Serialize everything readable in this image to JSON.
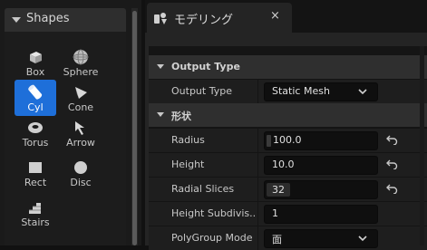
{
  "shapes_panel": {
    "title": "Shapes",
    "tools": [
      {
        "label": "Box",
        "icon": "box-icon"
      },
      {
        "label": "Sphere",
        "icon": "sphere-icon"
      },
      {
        "label": "Cyl",
        "icon": "cylinder-icon",
        "active": true
      },
      {
        "label": "Cone",
        "icon": "cone-icon"
      },
      {
        "label": "Torus",
        "icon": "torus-icon"
      },
      {
        "label": "Arrow",
        "icon": "arrow-icon"
      },
      {
        "label": "Rect",
        "icon": "rect-icon"
      },
      {
        "label": "Disc",
        "icon": "disc-icon"
      },
      {
        "label": "Stairs",
        "icon": "stairs-icon"
      }
    ]
  },
  "tab": {
    "title": "モデリング",
    "icon": "modeling-icon",
    "close_glyph": "×"
  },
  "details": {
    "output_type_category": "Output Type",
    "output_type_label": "Output Type",
    "output_type_value": "Static Mesh",
    "shape_category": "形状",
    "radius_label": "Radius",
    "radius_value": "100.0",
    "height_label": "Height",
    "height_value": "10.0",
    "radial_slices_label": "Radial Slices",
    "radial_slices_value": "32",
    "height_subdiv_label": "Height Subdivis...",
    "height_subdiv_value": "1",
    "polygroup_label": "PolyGroup Mode",
    "polygroup_value": "面"
  },
  "colors": {
    "accent": "#1e6fd9",
    "panel": "#242424",
    "field": "#0f0f0f"
  }
}
